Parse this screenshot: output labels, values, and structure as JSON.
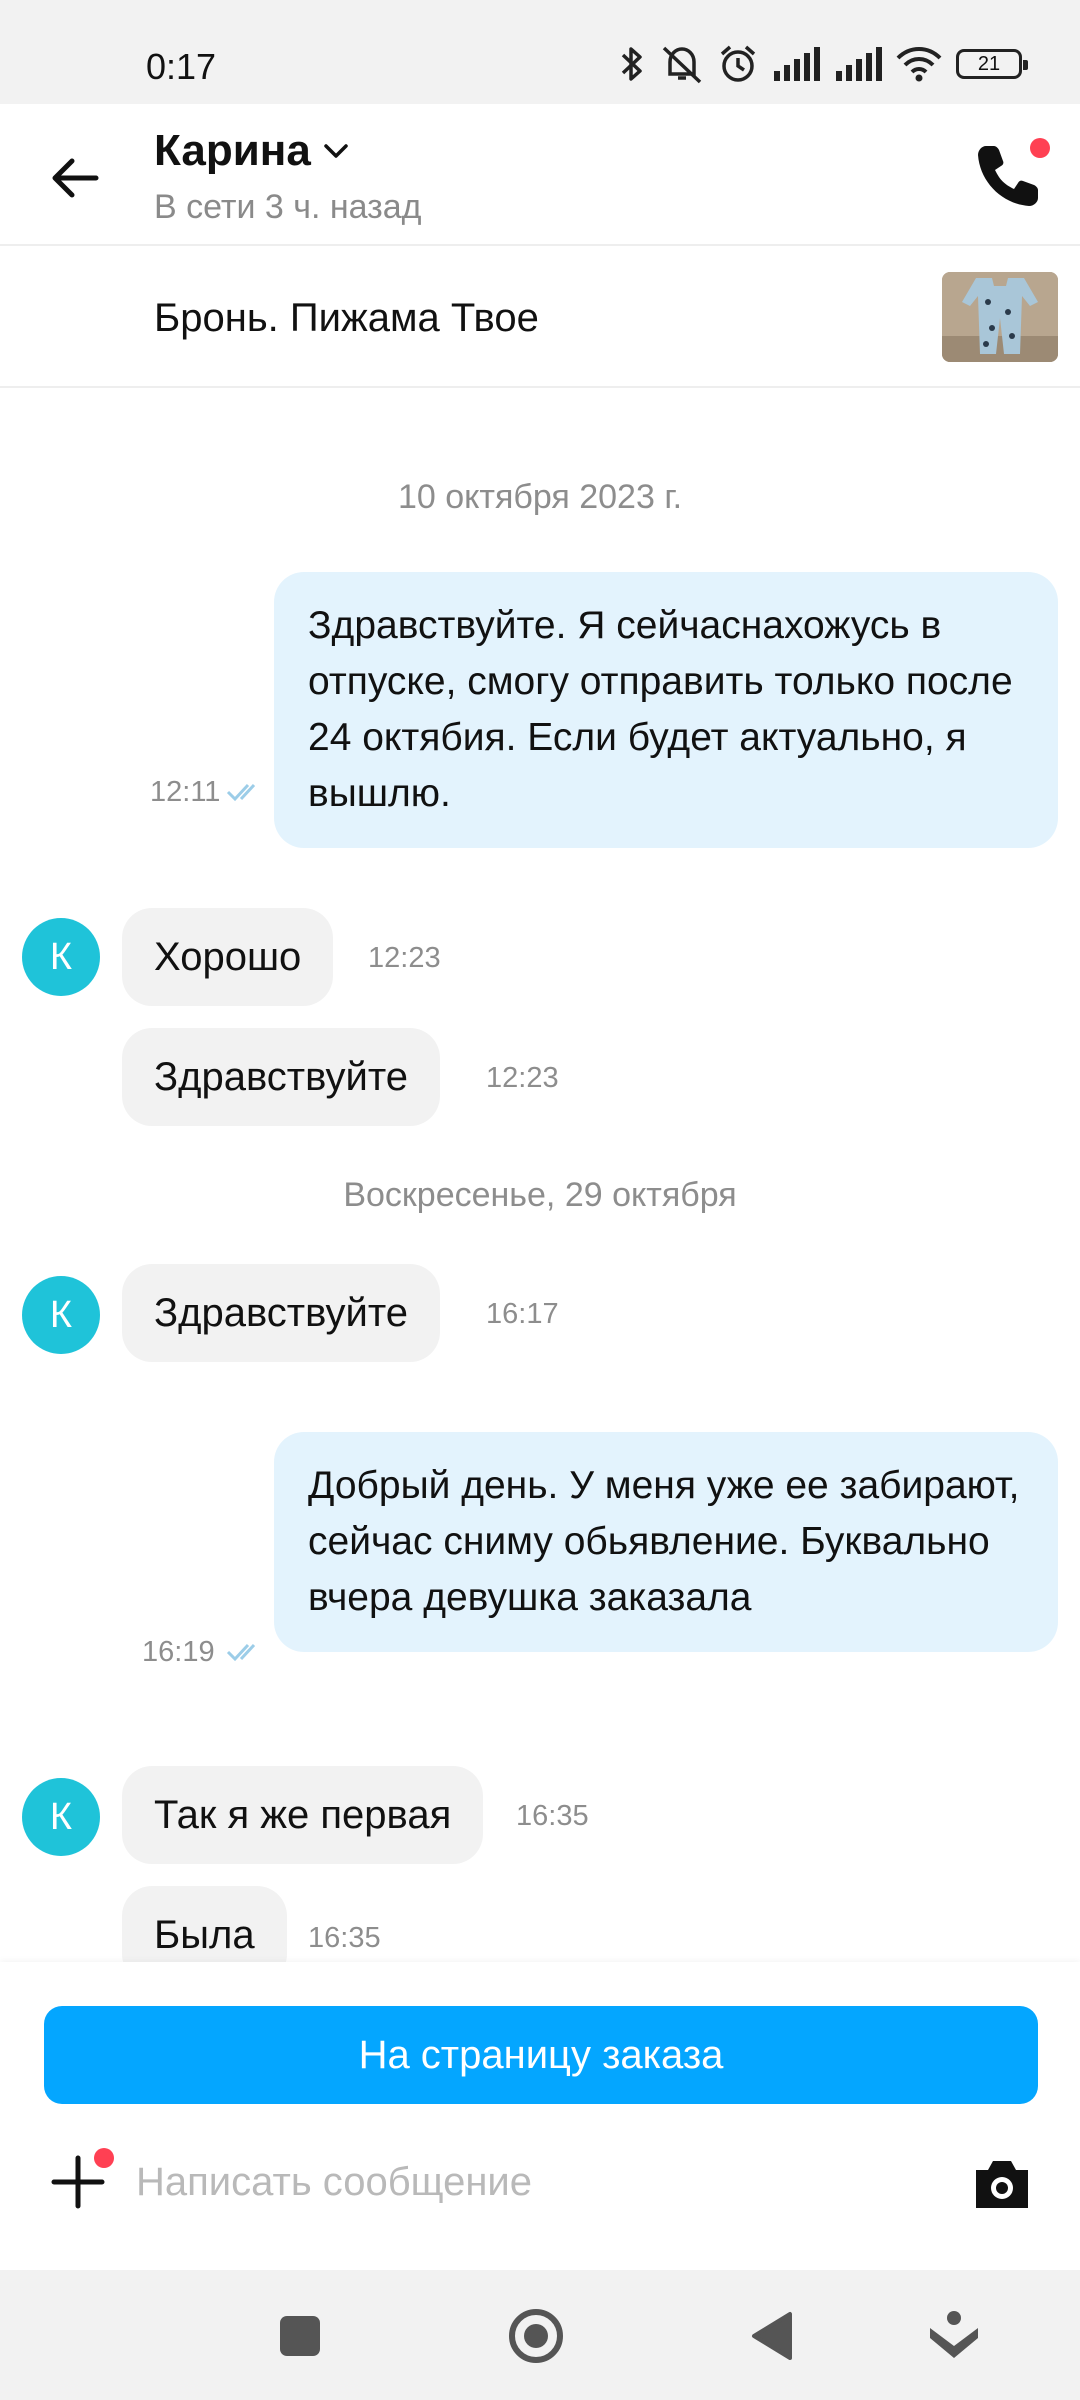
{
  "status_bar": {
    "time": "0:17",
    "battery": "21"
  },
  "header": {
    "contact_name": "Карина",
    "contact_status": "В сети 3 ч. назад"
  },
  "item": {
    "title": "Бронь. Пижама Твое"
  },
  "chat": {
    "date1": "10 октября 2023 г.",
    "msg1": {
      "text": "Здравствуйте. Я сейчаснахожусь в отпуске, смогу отправить только после 24 октябия. Если будет актуально, я вышлю.",
      "time": "12:11"
    },
    "msg2": {
      "text": "Хорошо",
      "time": "12:23"
    },
    "msg3": {
      "text": "Здравствуйте",
      "time": "12:23"
    },
    "date2": "Воскресенье, 29 октября",
    "msg4": {
      "text": "Здравствуйте",
      "time": "16:17"
    },
    "msg5": {
      "text": "Добрый день. У меня уже ее забирают, сейчас сниму обьявление. Буквально вчера девушка заказала",
      "time": "16:19"
    },
    "msg6": {
      "text": "Так я же первая",
      "time": "16:35"
    },
    "msg7": {
      "text": "Была",
      "time": "16:35"
    },
    "avatar_letter": "К"
  },
  "composer": {
    "order_button": "На страницу заказа",
    "placeholder": "Написать сообщение"
  },
  "colors": {
    "accent": "#04a6ff",
    "outgoing_bubble": "#e3f3fd",
    "incoming_bubble": "#f2f2f2",
    "avatar": "#1fc3d9",
    "notification_dot": "#ff4053"
  }
}
